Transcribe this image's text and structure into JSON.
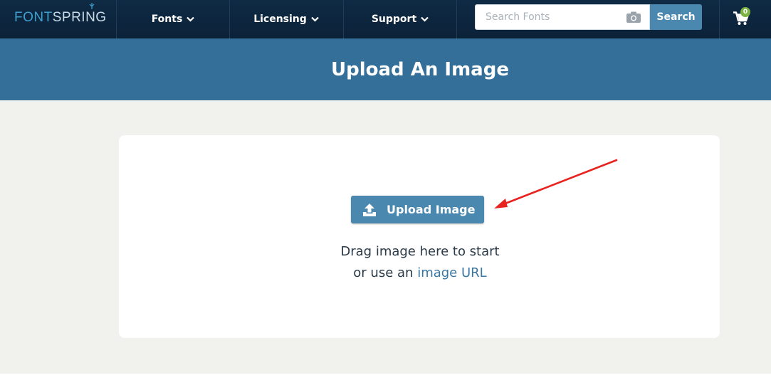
{
  "brand": {
    "logo_part1": "FONT",
    "logo_part2": "SPRING"
  },
  "nav": {
    "items": [
      {
        "label": "Fonts"
      },
      {
        "label": "Licensing"
      },
      {
        "label": "Support"
      }
    ]
  },
  "search": {
    "placeholder": "Search Fonts",
    "value": "",
    "button_label": "Search"
  },
  "cart": {
    "count": "0"
  },
  "header": {
    "title": "Upload An Image"
  },
  "upload": {
    "button_label": "Upload Image",
    "drag_line": "Drag image here to start",
    "url_prefix": "or use an ",
    "url_link": "image URL"
  },
  "colors": {
    "nav_bg": "#0f2a44",
    "header_bg": "#336f98",
    "accent": "#4a88b0",
    "content_bg": "#f1f1ed",
    "annotation_arrow": "#e8231f",
    "badge": "#7cb342"
  }
}
